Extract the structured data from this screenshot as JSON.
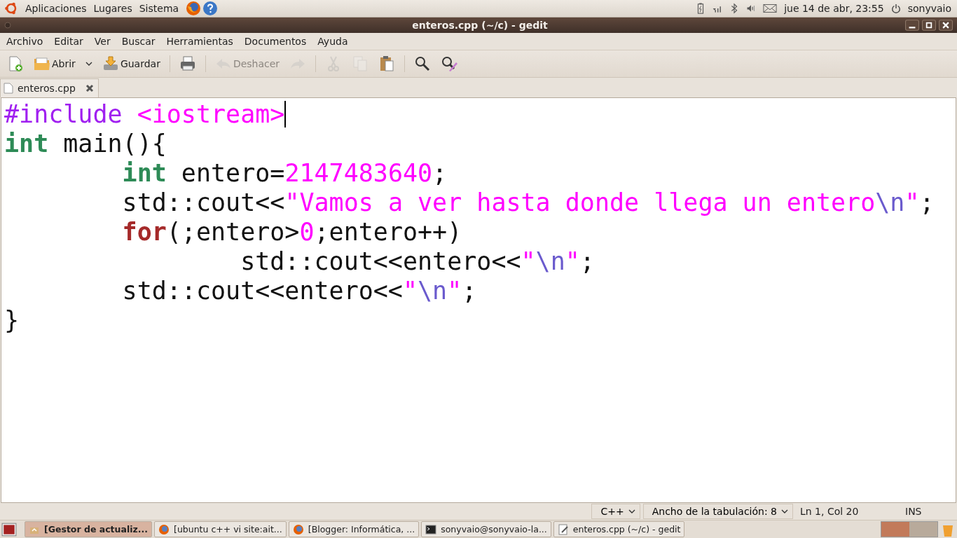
{
  "top_panel": {
    "menus": [
      "Aplicaciones",
      "Lugares",
      "Sistema"
    ],
    "clock": "jue 14 de abr, 23:55",
    "user": "sonyvaio"
  },
  "window": {
    "title": "enteros.cpp (~/c) - gedit"
  },
  "menubar": [
    "Archivo",
    "Editar",
    "Ver",
    "Buscar",
    "Herramientas",
    "Documentos",
    "Ayuda"
  ],
  "toolbar": [
    {
      "items": [
        {
          "kind": "new",
          "disabled": false
        },
        {
          "kind": "open",
          "label": "Abrir",
          "disabled": false
        },
        {
          "kind": "dropdown",
          "disabled": false
        },
        {
          "kind": "save",
          "label": "Guardar",
          "disabled": false
        }
      ]
    },
    {
      "items": [
        {
          "kind": "print",
          "disabled": false
        }
      ]
    },
    {
      "items": [
        {
          "kind": "undo",
          "label": "Deshacer",
          "disabled": true
        },
        {
          "kind": "redo",
          "disabled": true
        }
      ]
    },
    {
      "items": [
        {
          "kind": "cut",
          "disabled": true
        },
        {
          "kind": "copy",
          "disabled": true
        },
        {
          "kind": "paste",
          "disabled": false
        }
      ]
    },
    {
      "items": [
        {
          "kind": "find",
          "disabled": false
        },
        {
          "kind": "replace",
          "disabled": false
        }
      ]
    }
  ],
  "tabs": [
    {
      "label": "enteros.cpp",
      "selected": true
    }
  ],
  "code": [
    {
      "tokens": [
        {
          "text": "#include ",
          "kind": "preproc"
        },
        {
          "text": "<iostream>",
          "kind": "string"
        }
      ],
      "cursor": true
    },
    {
      "tokens": [
        {
          "text": "int",
          "kind": "type"
        },
        {
          "text": " main(){",
          "kind": "plain"
        }
      ],
      "cursor": false
    },
    {
      "tokens": [
        {
          "text": "\tint",
          "kind": "type"
        },
        {
          "text": " entero=",
          "kind": "plain"
        },
        {
          "text": "2147483640",
          "kind": "number"
        },
        {
          "text": ";",
          "kind": "plain"
        }
      ],
      "cursor": false
    },
    {
      "tokens": [
        {
          "text": "\tstd::cout<<",
          "kind": "plain"
        },
        {
          "text": "\"Vamos a ver hasta donde llega un entero",
          "kind": "string"
        },
        {
          "text": "\\n",
          "kind": "escape"
        },
        {
          "text": "\"",
          "kind": "string"
        },
        {
          "text": ";",
          "kind": "plain"
        }
      ],
      "cursor": false
    },
    {
      "tokens": [
        {
          "text": "\tfor",
          "kind": "keyword"
        },
        {
          "text": "(;entero>",
          "kind": "plain"
        },
        {
          "text": "0",
          "kind": "number"
        },
        {
          "text": ";entero++)",
          "kind": "plain"
        }
      ],
      "cursor": false
    },
    {
      "tokens": [
        {
          "text": "\t\tstd::cout<<entero<<",
          "kind": "plain"
        },
        {
          "text": "\"",
          "kind": "string"
        },
        {
          "text": "\\n",
          "kind": "escape"
        },
        {
          "text": "\"",
          "kind": "string"
        },
        {
          "text": ";",
          "kind": "plain"
        }
      ],
      "cursor": false
    },
    {
      "tokens": [
        {
          "text": "\tstd::cout<<entero<<",
          "kind": "plain"
        },
        {
          "text": "\"",
          "kind": "string"
        },
        {
          "text": "\\n",
          "kind": "escape"
        },
        {
          "text": "\"",
          "kind": "string"
        },
        {
          "text": ";",
          "kind": "plain"
        }
      ],
      "cursor": false
    },
    {
      "tokens": [
        {
          "text": "}",
          "kind": "plain"
        }
      ],
      "cursor": false
    }
  ],
  "status_bar": {
    "language": "C++",
    "tab_width": "Ancho de la tabulación:  8",
    "position": "Ln 1, Col 20",
    "mode": "INS"
  },
  "taskbar": [
    {
      "label": "[Gestor de actualiz...",
      "kind": "package",
      "selected": true
    },
    {
      "label": "[ubuntu c++ vi site:ait...",
      "kind": "browser",
      "selected": false
    },
    {
      "label": "[Blogger: Informática, ...",
      "kind": "browser",
      "selected": false
    },
    {
      "label": "sonyvaio@sonyvaio-la...",
      "kind": "terminal",
      "selected": false
    },
    {
      "label": "enteros.cpp (~/c) - gedit",
      "kind": "editor",
      "selected": false
    }
  ]
}
